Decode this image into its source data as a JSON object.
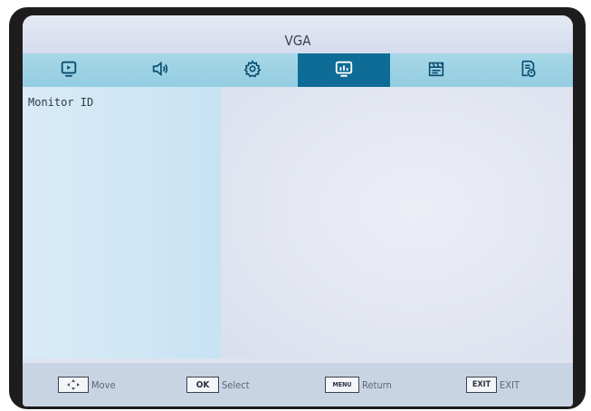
{
  "window": {
    "title": "VGA"
  },
  "tabs": [
    {
      "icon": "picture-icon",
      "active": false
    },
    {
      "icon": "speaker-icon",
      "active": false
    },
    {
      "icon": "gear-icon",
      "active": false
    },
    {
      "icon": "monitor-icon",
      "active": true
    },
    {
      "icon": "clapperboard-icon",
      "active": false
    },
    {
      "icon": "document-info-icon",
      "active": false
    }
  ],
  "menu": {
    "items": [
      {
        "label": "Monitor ID"
      }
    ]
  },
  "footer": {
    "move": {
      "icon": "dpad-icon",
      "label": "Move"
    },
    "select": {
      "key": "OK",
      "label": "Select"
    },
    "return": {
      "key": "MENU",
      "label": "Return"
    },
    "exit": {
      "key": "EXIT",
      "label": "EXIT"
    }
  },
  "colors": {
    "accent": "#0e6c97",
    "tab_bar": "#9fd3e5",
    "footer": "#c8d4e3"
  }
}
